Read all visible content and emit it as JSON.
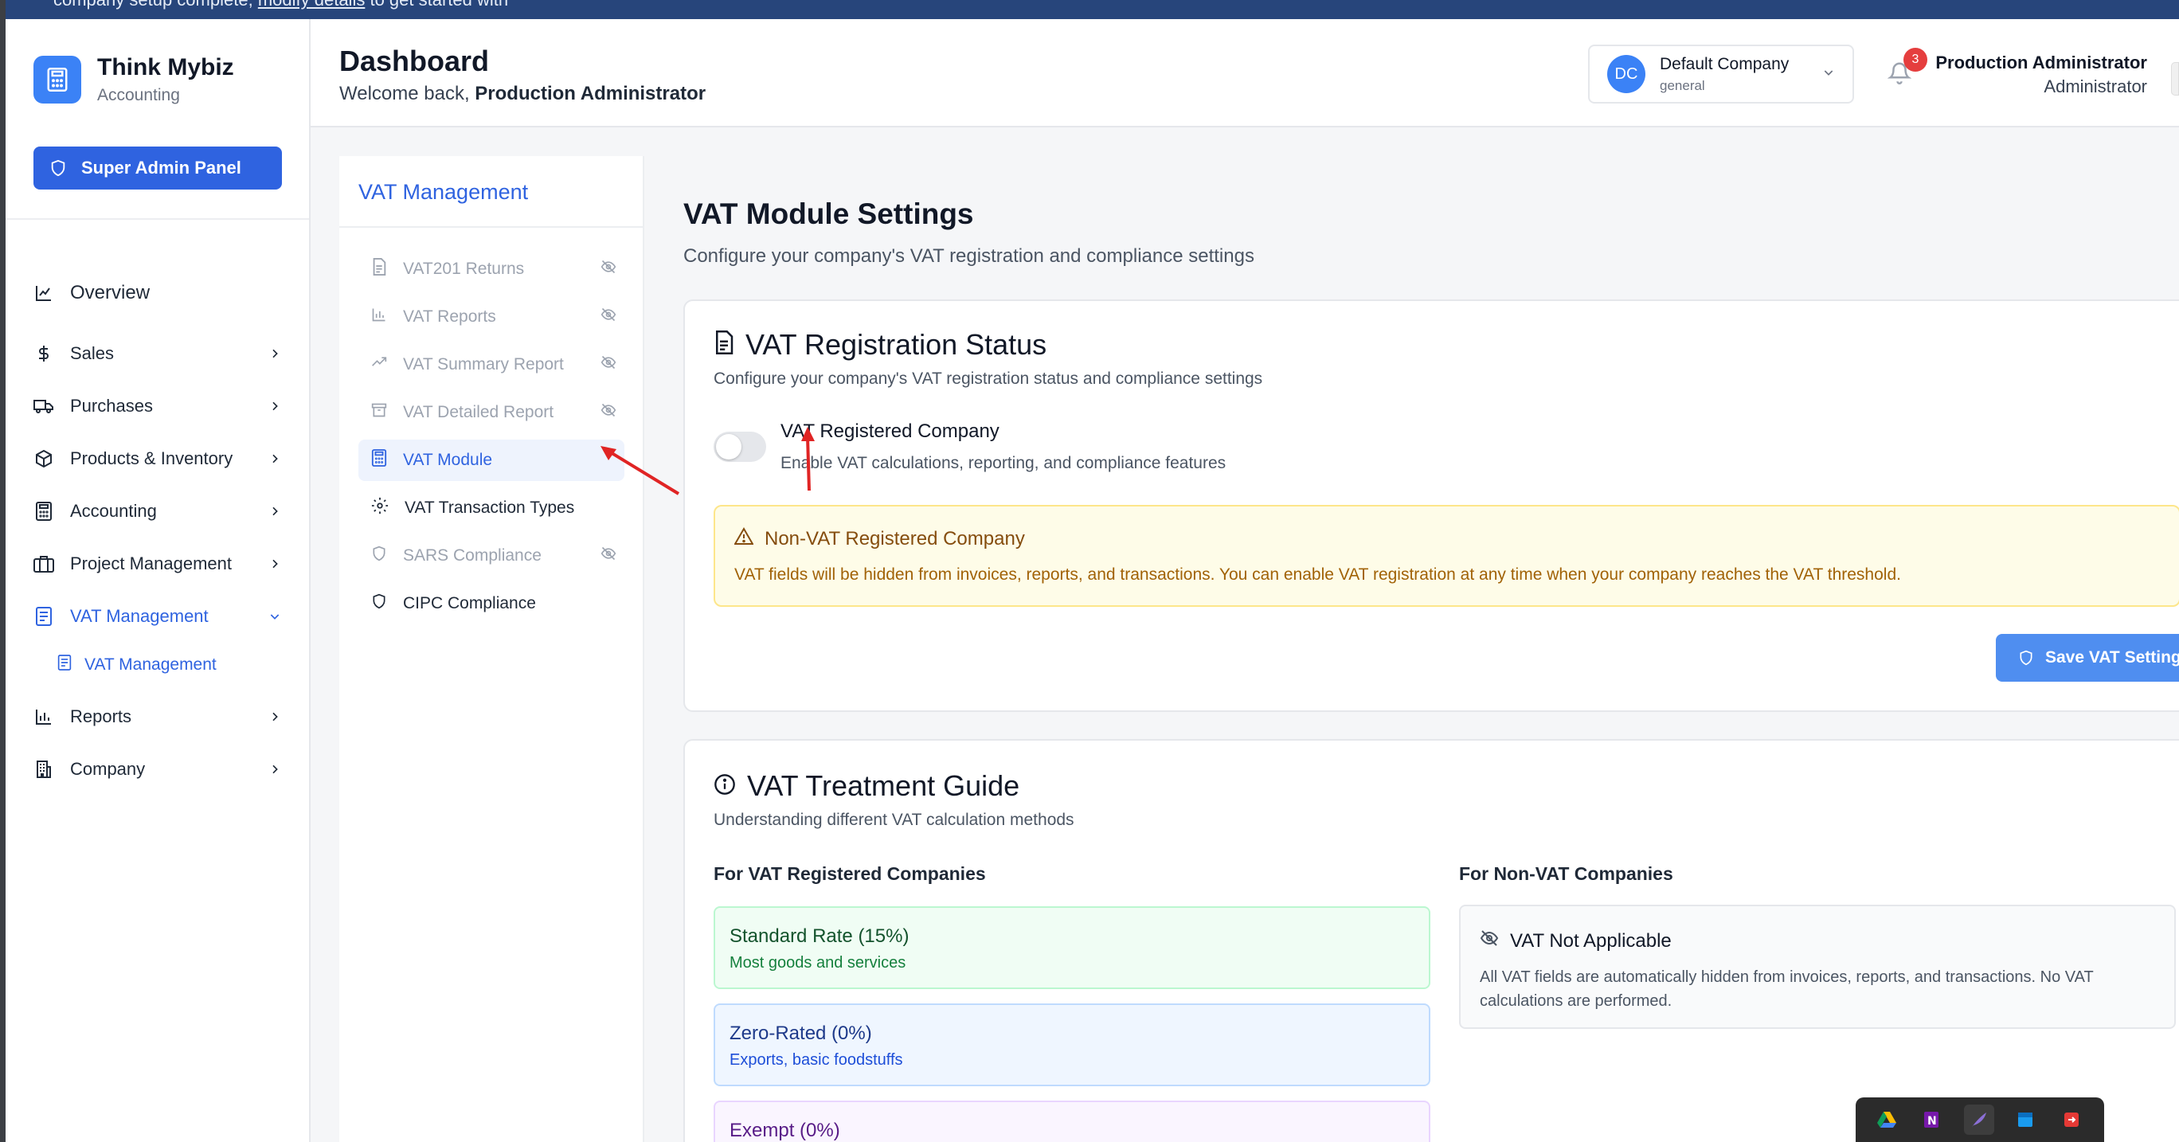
{
  "banner": {
    "text_left": "company setup complete,",
    "link": "modify details",
    "text_right": "to get started with"
  },
  "brand": {
    "name": "Think Mybiz",
    "sub": "Accounting"
  },
  "super_admin": {
    "label": "Super Admin Panel"
  },
  "nav": {
    "overview": "Overview",
    "sales": "Sales",
    "purchases": "Purchases",
    "products": "Products & Inventory",
    "accounting": "Accounting",
    "project": "Project Management",
    "vat": "VAT Management",
    "vat_sub": "VAT Management",
    "reports": "Reports",
    "company": "Company"
  },
  "header": {
    "title": "Dashboard",
    "welcome_prefix": "Welcome back, ",
    "welcome_user": "Production Administrator",
    "company_initials": "DC",
    "company_name": "Default Company",
    "company_sub": "general",
    "notifications": "3",
    "user_name": "Production Administrator",
    "user_role": "Administrator"
  },
  "subpanel": {
    "title": "VAT Management",
    "items": [
      {
        "label": "VAT201 Returns",
        "icon": "file-text-icon",
        "hidden": true
      },
      {
        "label": "VAT Reports",
        "icon": "bar-chart-icon",
        "hidden": true
      },
      {
        "label": "VAT Summary Report",
        "icon": "trending-up-icon",
        "hidden": true
      },
      {
        "label": "VAT Detailed Report",
        "icon": "archive-icon",
        "hidden": true
      },
      {
        "label": "VAT Module",
        "icon": "calculator-icon",
        "active": true
      },
      {
        "label": "VAT Transaction Types",
        "icon": "gear-icon"
      },
      {
        "label": "SARS Compliance",
        "icon": "shield-icon",
        "hidden": true
      },
      {
        "label": "CIPC Compliance",
        "icon": "shield-icon"
      }
    ]
  },
  "main": {
    "title": "VAT Module Settings",
    "subtitle": "Configure your company's VAT registration and compliance settings"
  },
  "registration": {
    "title": "VAT Registration Status",
    "subtitle": "Configure your company's VAT registration status and compliance settings",
    "toggle_label": "VAT Registered Company",
    "toggle_desc": "Enable VAT calculations, reporting, and compliance features",
    "toggle_on": false,
    "alert_title": "Non-VAT Registered Company",
    "alert_text": "VAT fields will be hidden from invoices, reports, and transactions. You can enable VAT registration at any time when your company reaches the VAT threshold.",
    "save_label": "Save VAT Settings"
  },
  "guide": {
    "title": "VAT Treatment Guide",
    "subtitle": "Understanding different VAT calculation methods",
    "left_heading": "For VAT Registered Companies",
    "right_heading": "For Non-VAT Companies",
    "rates": [
      {
        "name": "Standard Rate (15%)",
        "desc": "Most goods and services"
      },
      {
        "name": "Zero-Rated (0%)",
        "desc": "Exports, basic foodstuffs"
      },
      {
        "name": "Exempt (0%)",
        "desc": ""
      }
    ],
    "nonvat_title": "VAT Not Applicable",
    "nonvat_text": "All VAT fields are automatically hidden from invoices, reports, and transactions. No VAT calculations are performed."
  },
  "colors": {
    "primary": "#2f63e0",
    "banner": "#27457b",
    "annotation": "#e02424"
  }
}
